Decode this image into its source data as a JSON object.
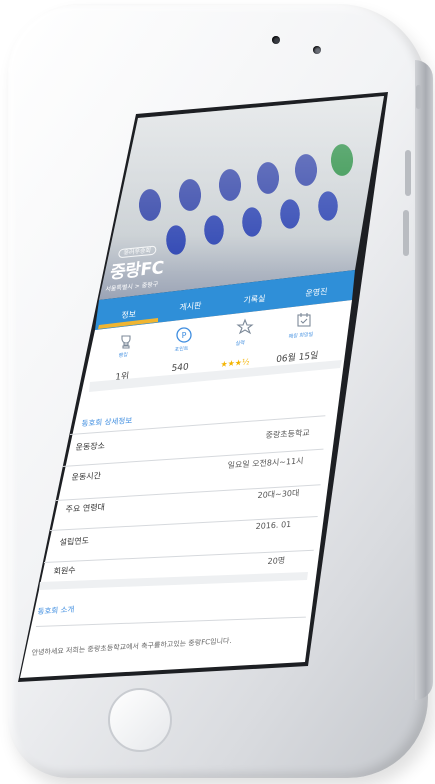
{
  "club": {
    "badge": "유러우승회",
    "name": "중랑FC",
    "location": "서울특별시 > 중랑구"
  },
  "tabs": [
    {
      "label": "정보",
      "active": true
    },
    {
      "label": "게시판",
      "active": false
    },
    {
      "label": "기록실",
      "active": false
    },
    {
      "label": "운영진",
      "active": false
    }
  ],
  "stats": [
    {
      "icon": "trophy-icon",
      "label": "랭킹",
      "value": "1위"
    },
    {
      "icon": "points-icon",
      "label": "포인트",
      "value": "540"
    },
    {
      "icon": "star-icon",
      "label": "실력",
      "value": "★★★½",
      "rating": 3.5
    },
    {
      "icon": "calendar-icon",
      "label": "매칭 희망일",
      "value": "06월 15일"
    }
  ],
  "details": {
    "title": "동호회 상세정보",
    "rows": [
      {
        "label": "",
        "value": "중랑초등학교"
      },
      {
        "label": "운동장소",
        "value": ""
      },
      {
        "label": "",
        "value": "일요일 오전8시~11시"
      },
      {
        "label": "운동시간",
        "value": ""
      },
      {
        "label": "",
        "value": "20대~30대"
      },
      {
        "label": "주요 연령대",
        "value": ""
      },
      {
        "label": "",
        "value": "2016. 01"
      },
      {
        "label": "설립연도",
        "value": ""
      },
      {
        "label": "회원수",
        "value": "20명"
      }
    ]
  },
  "intro": {
    "title": "동호회 소개",
    "text": "안녕하세요 저희는 중랑초등학교에서 축구를하고있는 중랑FC입니다."
  },
  "colors": {
    "accent": "#2f8fd8",
    "tab_indicator": "#f0b531",
    "section_title": "#3e8de0",
    "star": "#f4b400"
  }
}
